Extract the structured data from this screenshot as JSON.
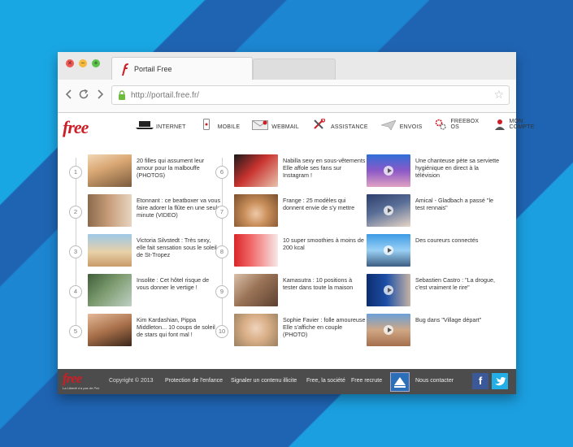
{
  "browser": {
    "tab_title": "Portail Free",
    "url": "http://portail.free.fr/"
  },
  "site": {
    "logo": "free",
    "menu": [
      {
        "label": "INTERNET",
        "icon": "laptop-icon"
      },
      {
        "label": "MOBILE",
        "icon": "mobile-icon"
      },
      {
        "label": "WEBMAIL",
        "icon": "mail-icon"
      },
      {
        "label": "ASSISTANCE",
        "icon": "tools-icon"
      },
      {
        "label": "ENVOIS",
        "icon": "paper-plane-icon"
      },
      {
        "label": "FREEBOX OS",
        "icon": "gear-icon"
      },
      {
        "label": "MON COMPTE",
        "icon": "user-icon"
      }
    ]
  },
  "ranked": {
    "col1": [
      {
        "n": "1",
        "text": "20 filles qui assument leur amour pour la malbouffe (PHOTOS)"
      },
      {
        "n": "2",
        "text": "Etonnant : ce beatboxer va vous faire adorer la flûte en une seule minute (VIDEO)"
      },
      {
        "n": "3",
        "text": "Victoria Silvstedt : Très sexy, elle fait sensation sous le soleil de St-Tropez"
      },
      {
        "n": "4",
        "text": "Insolite : Cet hôtel risque de vous donner le vertige !"
      },
      {
        "n": "5",
        "text": "Kim Kardashian, Pippa Middleton... 10 coups de soleil de stars qui font mal !"
      }
    ],
    "col2": [
      {
        "n": "6",
        "text": "Nabilla sexy en sous-vêtements Elle affole ses fans sur Instagram !"
      },
      {
        "n": "7",
        "text": "Frange : 25 modèles qui donnent envie de s'y mettre"
      },
      {
        "n": "8",
        "text": "10 super smoothies à moins de 200 kcal"
      },
      {
        "n": "9",
        "text": "Kamasutra : 10 positions à tester dans toute la maison"
      },
      {
        "n": "10",
        "text": "Sophie Favier : folle amoureuse Elle s'affiche en couple (PHOTO)"
      }
    ]
  },
  "videos": [
    {
      "text": "Une chanteuse pète sa serviette hygiénique en direct à la télévision"
    },
    {
      "text": "Amical - Gladbach a passé \"le test rennais\""
    },
    {
      "text": "Des coureurs connectés"
    },
    {
      "text": "Sebastien Castro : \"La drogue, c'est vraiment le rire\""
    },
    {
      "text": "Bug dans \"Village départ\""
    }
  ],
  "footer": {
    "logo": "free",
    "tagline": "La Liberté n'a pas de Prix",
    "copyright": "Copyright © 2013",
    "links": [
      "Protection de l'enfance",
      "Signaler un contenu illicite",
      "Free, la société",
      "Free recrute",
      "Nous contacter"
    ]
  },
  "colors": {
    "brand_red": "#cd1e25",
    "footer_bg": "#4c4c4c",
    "facebook": "#3b5998",
    "twitter": "#22aee6"
  }
}
